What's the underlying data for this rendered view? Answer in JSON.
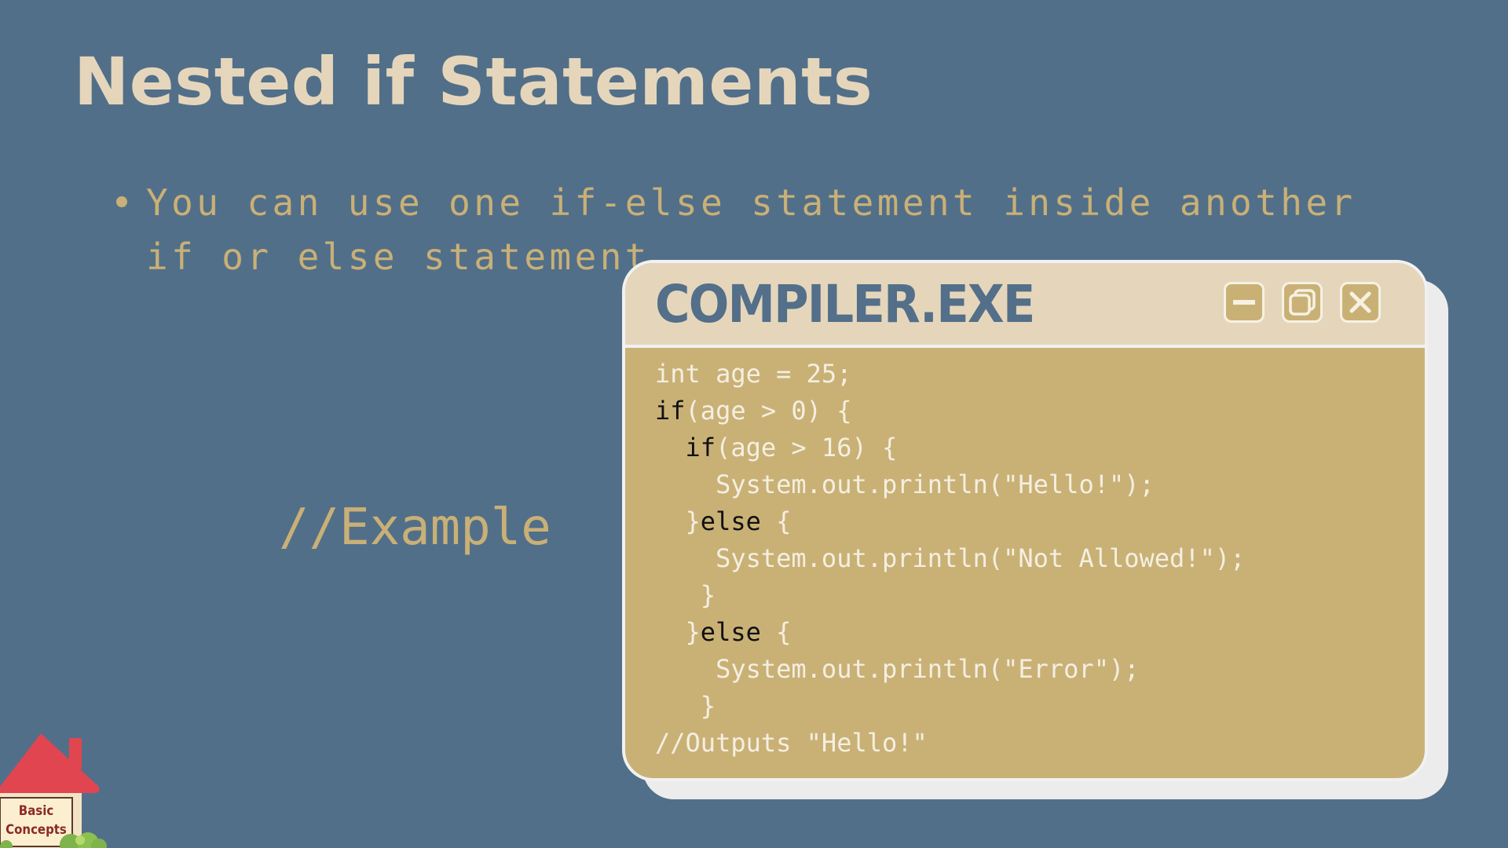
{
  "slide": {
    "title": "Nested if Statements",
    "bullet": "You can use one if-else statement inside another if or else statement.",
    "example_label": "//Example"
  },
  "window": {
    "title": "COMPILER.EXE",
    "controls": [
      "minimize-icon",
      "restore-icon",
      "close-icon"
    ],
    "code_lines": [
      {
        "kw": "",
        "text": "int age = 25;"
      },
      {
        "kw": "if",
        "text": "(age > 0) {"
      },
      {
        "kw": "  if",
        "text": "(age > 16) {"
      },
      {
        "kw": "",
        "text": "    System.out.println(\"Hello!\");"
      },
      {
        "pre": "  }",
        "kw": "else",
        "text": " {"
      },
      {
        "kw": "",
        "text": "    System.out.println(\"Not Allowed!\");"
      },
      {
        "kw": "",
        "text": "   }"
      },
      {
        "pre": "  }",
        "kw": "else",
        "text": " {"
      },
      {
        "kw": "",
        "text": "    System.out.println(\"Error\");"
      },
      {
        "kw": "",
        "text": "   }"
      },
      {
        "kw": "",
        "text": "//Outputs \"Hello!\""
      }
    ]
  },
  "badge": {
    "line1": "Basic",
    "line2": "Concepts"
  },
  "colors": {
    "background": "#526f89",
    "title": "#e5d6bb",
    "accent": "#c9b076",
    "window_body": "#c9b176",
    "window_titlebar": "#e5d6bb",
    "keyword": "#111111",
    "code_text": "#f5efe1"
  }
}
